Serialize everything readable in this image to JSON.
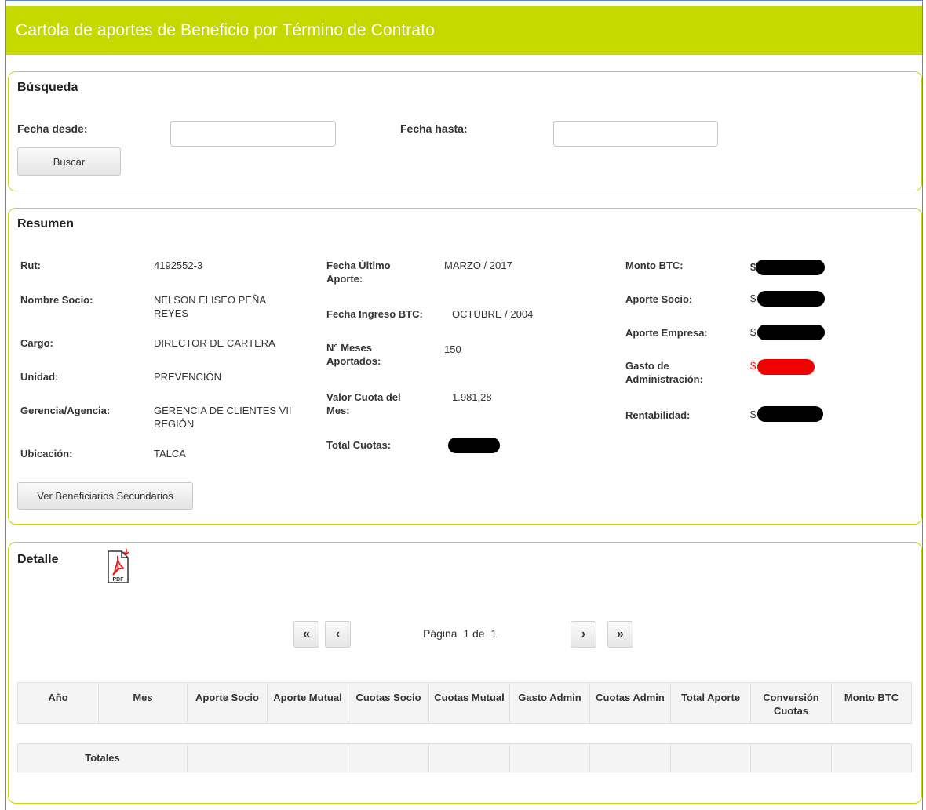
{
  "header": {
    "title": "Cartola de aportes de Beneficio por Término de Contrato"
  },
  "busqueda": {
    "title": "Búsqueda",
    "fecha_desde_label": "Fecha desde:",
    "fecha_desde_value": "",
    "fecha_hasta_label": "Fecha hasta:",
    "fecha_hasta_value": "",
    "buscar_label": "Buscar"
  },
  "resumen": {
    "title": "Resumen",
    "col1": [
      {
        "label": "Rut:",
        "value": "4192552-3"
      },
      {
        "label": "Nombre Socio:",
        "value": "NELSON ELISEO PEÑA REYES"
      },
      {
        "label": "Cargo:",
        "value": "DIRECTOR DE CARTERA"
      },
      {
        "label": "Unidad:",
        "value": "PREVENCIÓN"
      },
      {
        "label": "Gerencia/Agencia:",
        "value": "GERENCIA DE CLIENTES VII REGIÓN"
      },
      {
        "label": "Ubicación:",
        "value": "TALCA"
      }
    ],
    "col2": [
      {
        "label": "Fecha Último Aporte:",
        "value": "MARZO / 2017"
      },
      {
        "label": "Fecha Ingreso BTC:",
        "value": "OCTUBRE / 2004"
      },
      {
        "label": "N° Meses Aportados:",
        "value": "150"
      },
      {
        "label": "Valor Cuota del Mes:",
        "value": "1.981,28"
      },
      {
        "label": "Total Cuotas:",
        "value": ""
      }
    ],
    "col3": [
      {
        "label": "Monto BTC:",
        "currency": "$"
      },
      {
        "label": "Aporte Socio:",
        "currency": "$"
      },
      {
        "label": "Aporte Empresa:",
        "currency": "$"
      },
      {
        "label": "Gasto de Administración:",
        "currency": "$"
      },
      {
        "label": "Rentabilidad:",
        "currency": "$"
      }
    ],
    "secundarios_button": "Ver Beneficiarios Secundarios"
  },
  "detalle": {
    "title": "Detalle",
    "pdf_icon_text": "PDF",
    "pagination": {
      "first": "«",
      "prev": "‹",
      "next": "›",
      "last": "»",
      "text": "Página  1 de  1"
    },
    "table": {
      "headers": [
        "Año",
        "Mes",
        "Aporte Socio",
        "Aporte Mutual",
        "Cuotas Socio",
        "Cuotas Mutual",
        "Gasto Admin",
        "Cuotas Admin",
        "Total Aporte",
        "Conversión Cuotas",
        "Monto BTC"
      ],
      "totals_label": "Totales"
    }
  }
}
